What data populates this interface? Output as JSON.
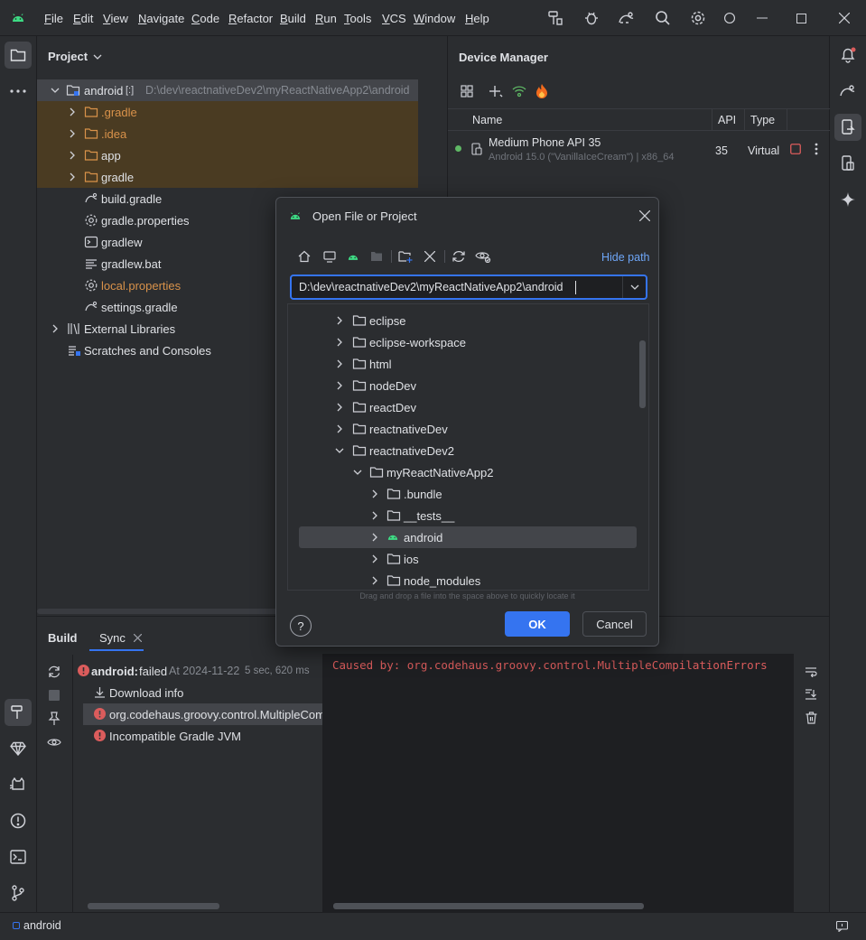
{
  "menu": [
    "File",
    "Edit",
    "View",
    "Navigate",
    "Code",
    "Refactor",
    "Build",
    "Run",
    "Tools",
    "VCS",
    "Window",
    "Help"
  ],
  "project": {
    "title": "Project",
    "root_label": "android",
    "root_badge": "[:]",
    "root_path": "D:\\dev\\reactnativeDev2\\myReactNativeApp2\\android",
    "items": [
      {
        "label": ".gradle"
      },
      {
        "label": ".idea"
      },
      {
        "label": "app"
      },
      {
        "label": "gradle"
      },
      {
        "label": "build.gradle"
      },
      {
        "label": "gradle.properties"
      },
      {
        "label": "gradlew"
      },
      {
        "label": "gradlew.bat"
      },
      {
        "label": "local.properties"
      },
      {
        "label": "settings.gradle"
      },
      {
        "label": "External Libraries"
      },
      {
        "label": "Scratches and Consoles"
      }
    ]
  },
  "device_manager": {
    "title": "Device Manager",
    "columns": {
      "name": "Name",
      "api": "API",
      "type": "Type"
    },
    "device": {
      "name": "Medium Phone API 35",
      "detail": "Android 15.0 (\"VanillaIceCream\") | x86_64",
      "api": "35",
      "type": "Virtual"
    }
  },
  "dialog": {
    "title": "Open File or Project",
    "hide_path": "Hide path",
    "path_value": "D:\\dev\\reactnativeDev2\\myReactNativeApp2\\android",
    "tree": [
      {
        "label": "eclipse"
      },
      {
        "label": "eclipse-workspace"
      },
      {
        "label": "html"
      },
      {
        "label": "nodeDev"
      },
      {
        "label": "reactDev"
      },
      {
        "label": "reactnativeDev"
      },
      {
        "label": "reactnativeDev2"
      },
      {
        "label": "myReactNativeApp2"
      },
      {
        "label": ".bundle"
      },
      {
        "label": "__tests__"
      },
      {
        "label": "android"
      },
      {
        "label": "ios"
      },
      {
        "label": "node_modules"
      }
    ],
    "drop_hint": "Drag and drop a file into the space above to quickly locate it",
    "ok": "OK",
    "cancel": "Cancel"
  },
  "build": {
    "tab_build": "Build",
    "tab_sync": "Sync",
    "result_name": "android:",
    "result_status": "failed",
    "result_time": "At 2024-11-22",
    "result_duration": "5 sec, 620 ms",
    "items": [
      {
        "label": "Download info"
      },
      {
        "label": "org.codehaus.groovy.control.MultipleCompi"
      },
      {
        "label": "Incompatible Gradle JVM"
      }
    ],
    "console_text": "Caused by: org.codehaus.groovy.control.MultipleCompilationErrors"
  },
  "status": {
    "project": "android"
  },
  "colors": {
    "accent": "#3574f0",
    "error": "#db5c5c",
    "android_green": "#3ddc84",
    "highlight_folder": "#4a3b22"
  }
}
